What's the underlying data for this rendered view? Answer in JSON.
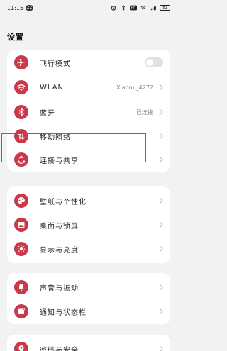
{
  "status_bar": {
    "time": "11:15",
    "notification_count": "22",
    "battery": "81"
  },
  "page": {
    "title": "设置"
  },
  "cards": [
    {
      "items": [
        {
          "label": "飞行模式",
          "icon": "airplane-icon",
          "control": "toggle",
          "toggle_on": false
        },
        {
          "label": "WLAN",
          "icon": "wifi-icon",
          "value": "Xiaomi_4272"
        },
        {
          "label": "蓝牙",
          "icon": "bluetooth-icon",
          "value": "已连接"
        },
        {
          "label": "移动网络",
          "icon": "mobile-data-icon"
        },
        {
          "label": "连接与共享",
          "icon": "share-icon",
          "highlighted": true
        }
      ]
    },
    {
      "items": [
        {
          "label": "壁纸与个性化",
          "icon": "palette-icon"
        },
        {
          "label": "桌面与锁屏",
          "icon": "image-icon"
        },
        {
          "label": "显示与亮度",
          "icon": "brightness-icon"
        }
      ]
    },
    {
      "items": [
        {
          "label": "声音与振动",
          "icon": "bell-icon"
        },
        {
          "label": "通知与状态栏",
          "icon": "notification-icon"
        }
      ]
    },
    {
      "items": [
        {
          "label": "密码与安全",
          "icon": "location-icon"
        }
      ]
    }
  ],
  "colors": {
    "icon_bg": "#c9394a",
    "highlight_border": "#e23b3b",
    "page_bg": "#f2f2f2"
  }
}
